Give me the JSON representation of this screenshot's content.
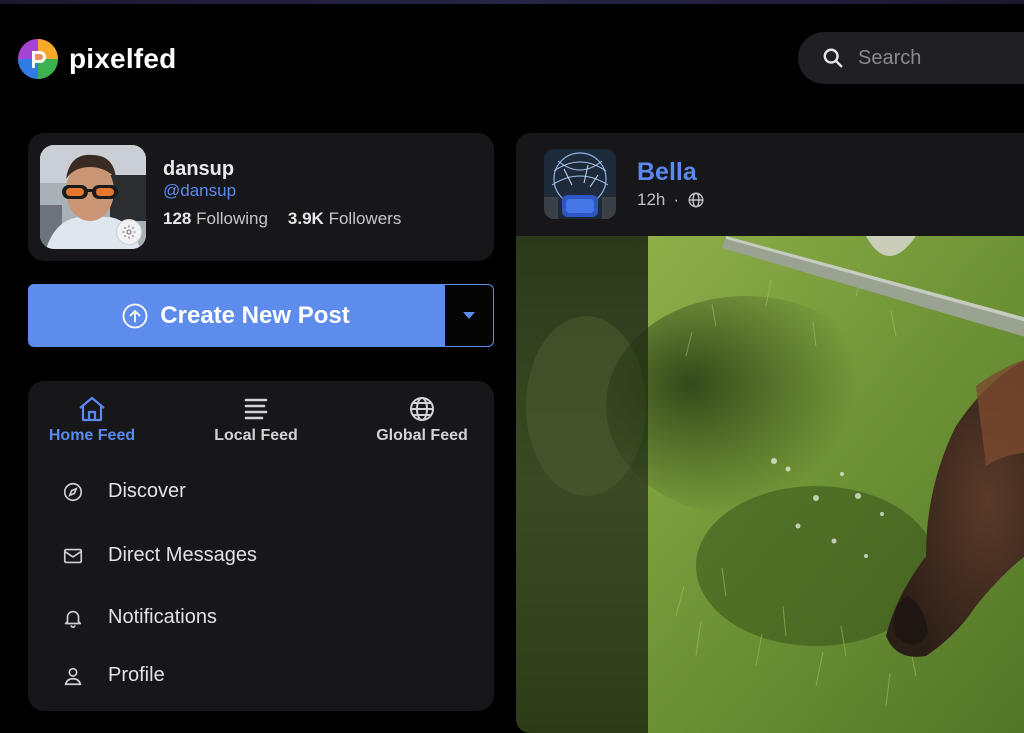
{
  "header": {
    "brand": "pixelfed",
    "search_placeholder": "Search"
  },
  "profile": {
    "name": "dansup",
    "handle": "@dansup",
    "following_count": "128",
    "following_label": "Following",
    "followers_count": "3.9K",
    "followers_label": "Followers"
  },
  "compose": {
    "create_label": "Create New Post"
  },
  "feeds": [
    {
      "label": "Home Feed",
      "icon": "home-icon",
      "active": true
    },
    {
      "label": "Local Feed",
      "icon": "list-icon",
      "active": false
    },
    {
      "label": "Global Feed",
      "icon": "globe-icon",
      "active": false
    }
  ],
  "nav": {
    "items": [
      {
        "label": "Discover",
        "icon": "compass-icon"
      },
      {
        "label": "Direct Messages",
        "icon": "envelope-icon"
      },
      {
        "label": "Notifications",
        "icon": "bell-icon"
      },
      {
        "label": "Profile",
        "icon": "user-icon"
      }
    ]
  },
  "post": {
    "username": "Bella",
    "time": "12h",
    "separator": "·",
    "visibility_icon": "globe-icon"
  },
  "colors": {
    "accent": "#5d8cec",
    "background": "#000000",
    "card": "#17171a",
    "link": "#5a89f0"
  }
}
